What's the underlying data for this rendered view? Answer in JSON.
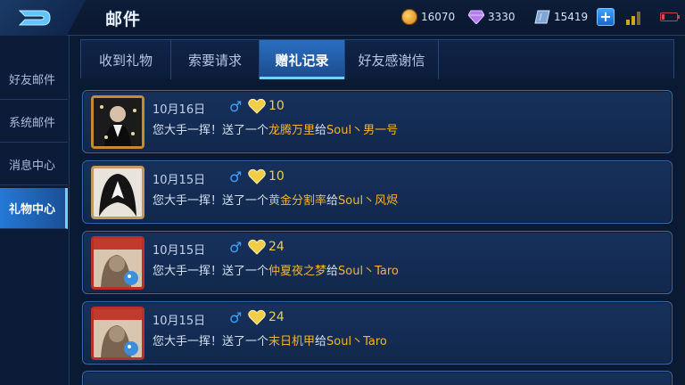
{
  "window": {
    "title": "邮件"
  },
  "currency": {
    "coins": "16070",
    "diamonds": "3330",
    "vouchers": "15419"
  },
  "sidebar": {
    "items": [
      {
        "label": "好友邮件"
      },
      {
        "label": "系统邮件"
      },
      {
        "label": "消息中心"
      },
      {
        "label": "礼物中心",
        "active": true
      }
    ]
  },
  "tabs": [
    {
      "label": "收到礼物"
    },
    {
      "label": "索要请求"
    },
    {
      "label": "赠礼记录",
      "active": true
    },
    {
      "label": "好友感谢信"
    }
  ],
  "records": [
    {
      "date": "10月16日",
      "gender": "♂",
      "charm": "10",
      "prefix": "您大手一挥！送了一个",
      "gift": "龙腾万里",
      "mid": "给",
      "target": "Soul丶男一号"
    },
    {
      "date": "10月15日",
      "gender": "♂",
      "charm": "10",
      "prefix": "您大手一挥！送了一个",
      "gift": "黄金分割率",
      "mid": "给",
      "target": "Soul丶风烬"
    },
    {
      "date": "10月15日",
      "gender": "♂",
      "charm": "24",
      "prefix": "您大手一挥！送了一个",
      "gift": "仲夏夜之梦",
      "mid": "给",
      "target": "Soul丶Taro"
    },
    {
      "date": "10月15日",
      "gender": "♂",
      "charm": "24",
      "prefix": "您大手一挥！送了一个",
      "gift": "末日机甲",
      "mid": "给",
      "target": "Soul丶Taro"
    }
  ],
  "colors": {
    "accent": "#2a6fc2",
    "highlight_text": "#f5b52f",
    "charm_text": "#f2cd47",
    "gender_male": "#3fa2ff"
  },
  "icons": {
    "back": "back-arrow-icon",
    "coin": "coin-icon",
    "diamond": "diamond-icon",
    "voucher": "voucher-icon",
    "add": "plus-icon",
    "signal": "signal-icon",
    "battery": "battery-icon",
    "charm": "heart-icon"
  }
}
